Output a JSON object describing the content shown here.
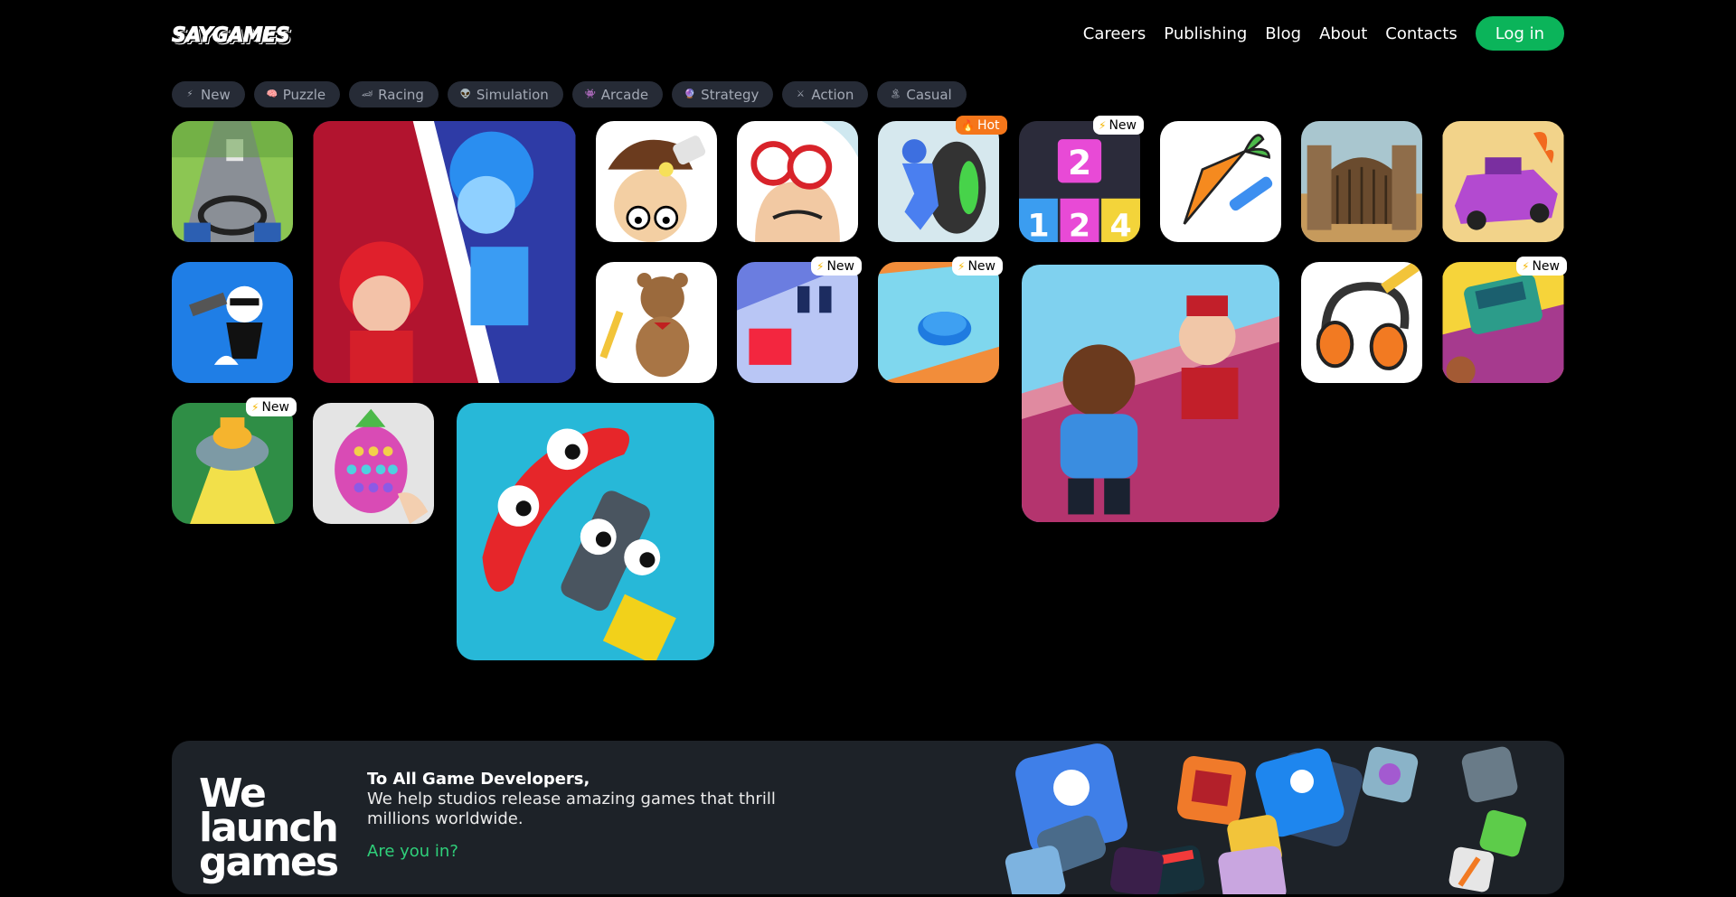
{
  "header": {
    "logo_text": "SAYGAMES",
    "nav": [
      "Careers",
      "Publishing",
      "Blog",
      "About",
      "Contacts"
    ],
    "login_label": "Log in"
  },
  "filters": [
    {
      "label": "New",
      "icon": "⚡",
      "icon_name": "lightning-icon"
    },
    {
      "label": "Puzzle",
      "icon": "🧠",
      "icon_name": "brain-icon"
    },
    {
      "label": "Racing",
      "icon": "🏎",
      "icon_name": "racecar-icon"
    },
    {
      "label": "Simulation",
      "icon": "👽",
      "icon_name": "alien-icon"
    },
    {
      "label": "Arcade",
      "icon": "👾",
      "icon_name": "arcade-icon"
    },
    {
      "label": "Strategy",
      "icon": "🔮",
      "icon_name": "crystal-ball-icon"
    },
    {
      "label": "Action",
      "icon": "⚔",
      "icon_name": "swords-icon"
    },
    {
      "label": "Casual",
      "icon": "🏝",
      "icon_name": "island-icon"
    }
  ],
  "badges": {
    "hot": "Hot",
    "new": "New"
  },
  "banner": {
    "headline": [
      "We",
      "launch",
      "games"
    ],
    "heading": "To All Game Developers,",
    "body": "We help studios release amazing games that thrill millions worldwide.",
    "cta": "Are you in?"
  },
  "colors": {
    "accent": "#0bb45a",
    "chip_bg": "#262b36",
    "banner_bg": "#1d2228",
    "hot_badge": "#f5761a"
  }
}
